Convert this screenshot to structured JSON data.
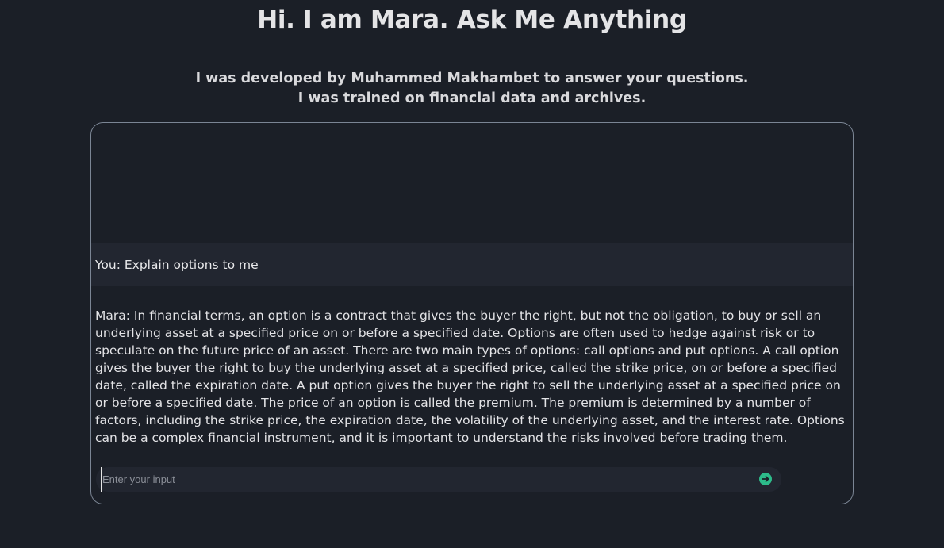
{
  "header": {
    "title": "Hi. I am Mara. Ask Me Anything",
    "subtitle_line1": "I was developed by Muhammed Makhambet to answer your questions.",
    "subtitle_line2": "I was trained on financial data and archives."
  },
  "chat": {
    "messages": [
      {
        "role": "user",
        "text": "You: Explain options to me"
      },
      {
        "role": "bot",
        "text": "Mara: In financial terms, an option is a contract that gives the buyer the right, but not the obligation, to buy or sell an underlying asset at a specified price on or before a specified date. Options are often used to hedge against risk or to speculate on the future price of an asset. There are two main types of options: call options and put options. A call option gives the buyer the right to buy the underlying asset at a specified price, called the strike price, on or before a specified date, called the expiration date. A put option gives the buyer the right to sell the underlying asset at a specified price on or before a specified date. The price of an option is called the premium. The premium is determined by a number of factors, including the strike price, the expiration date, the volatility of the underlying asset, and the interest rate. Options can be a complex financial instrument, and it is important to understand the risks involved before trading them."
      }
    ]
  },
  "input": {
    "value": "",
    "placeholder": "Enter your input"
  },
  "send_button": {
    "icon": "arrow-right-icon",
    "color": "#2dbb8a"
  },
  "colors": {
    "background": "#1b1f27",
    "user_message_bg": "#222630",
    "panel_border": "#7b8594"
  }
}
